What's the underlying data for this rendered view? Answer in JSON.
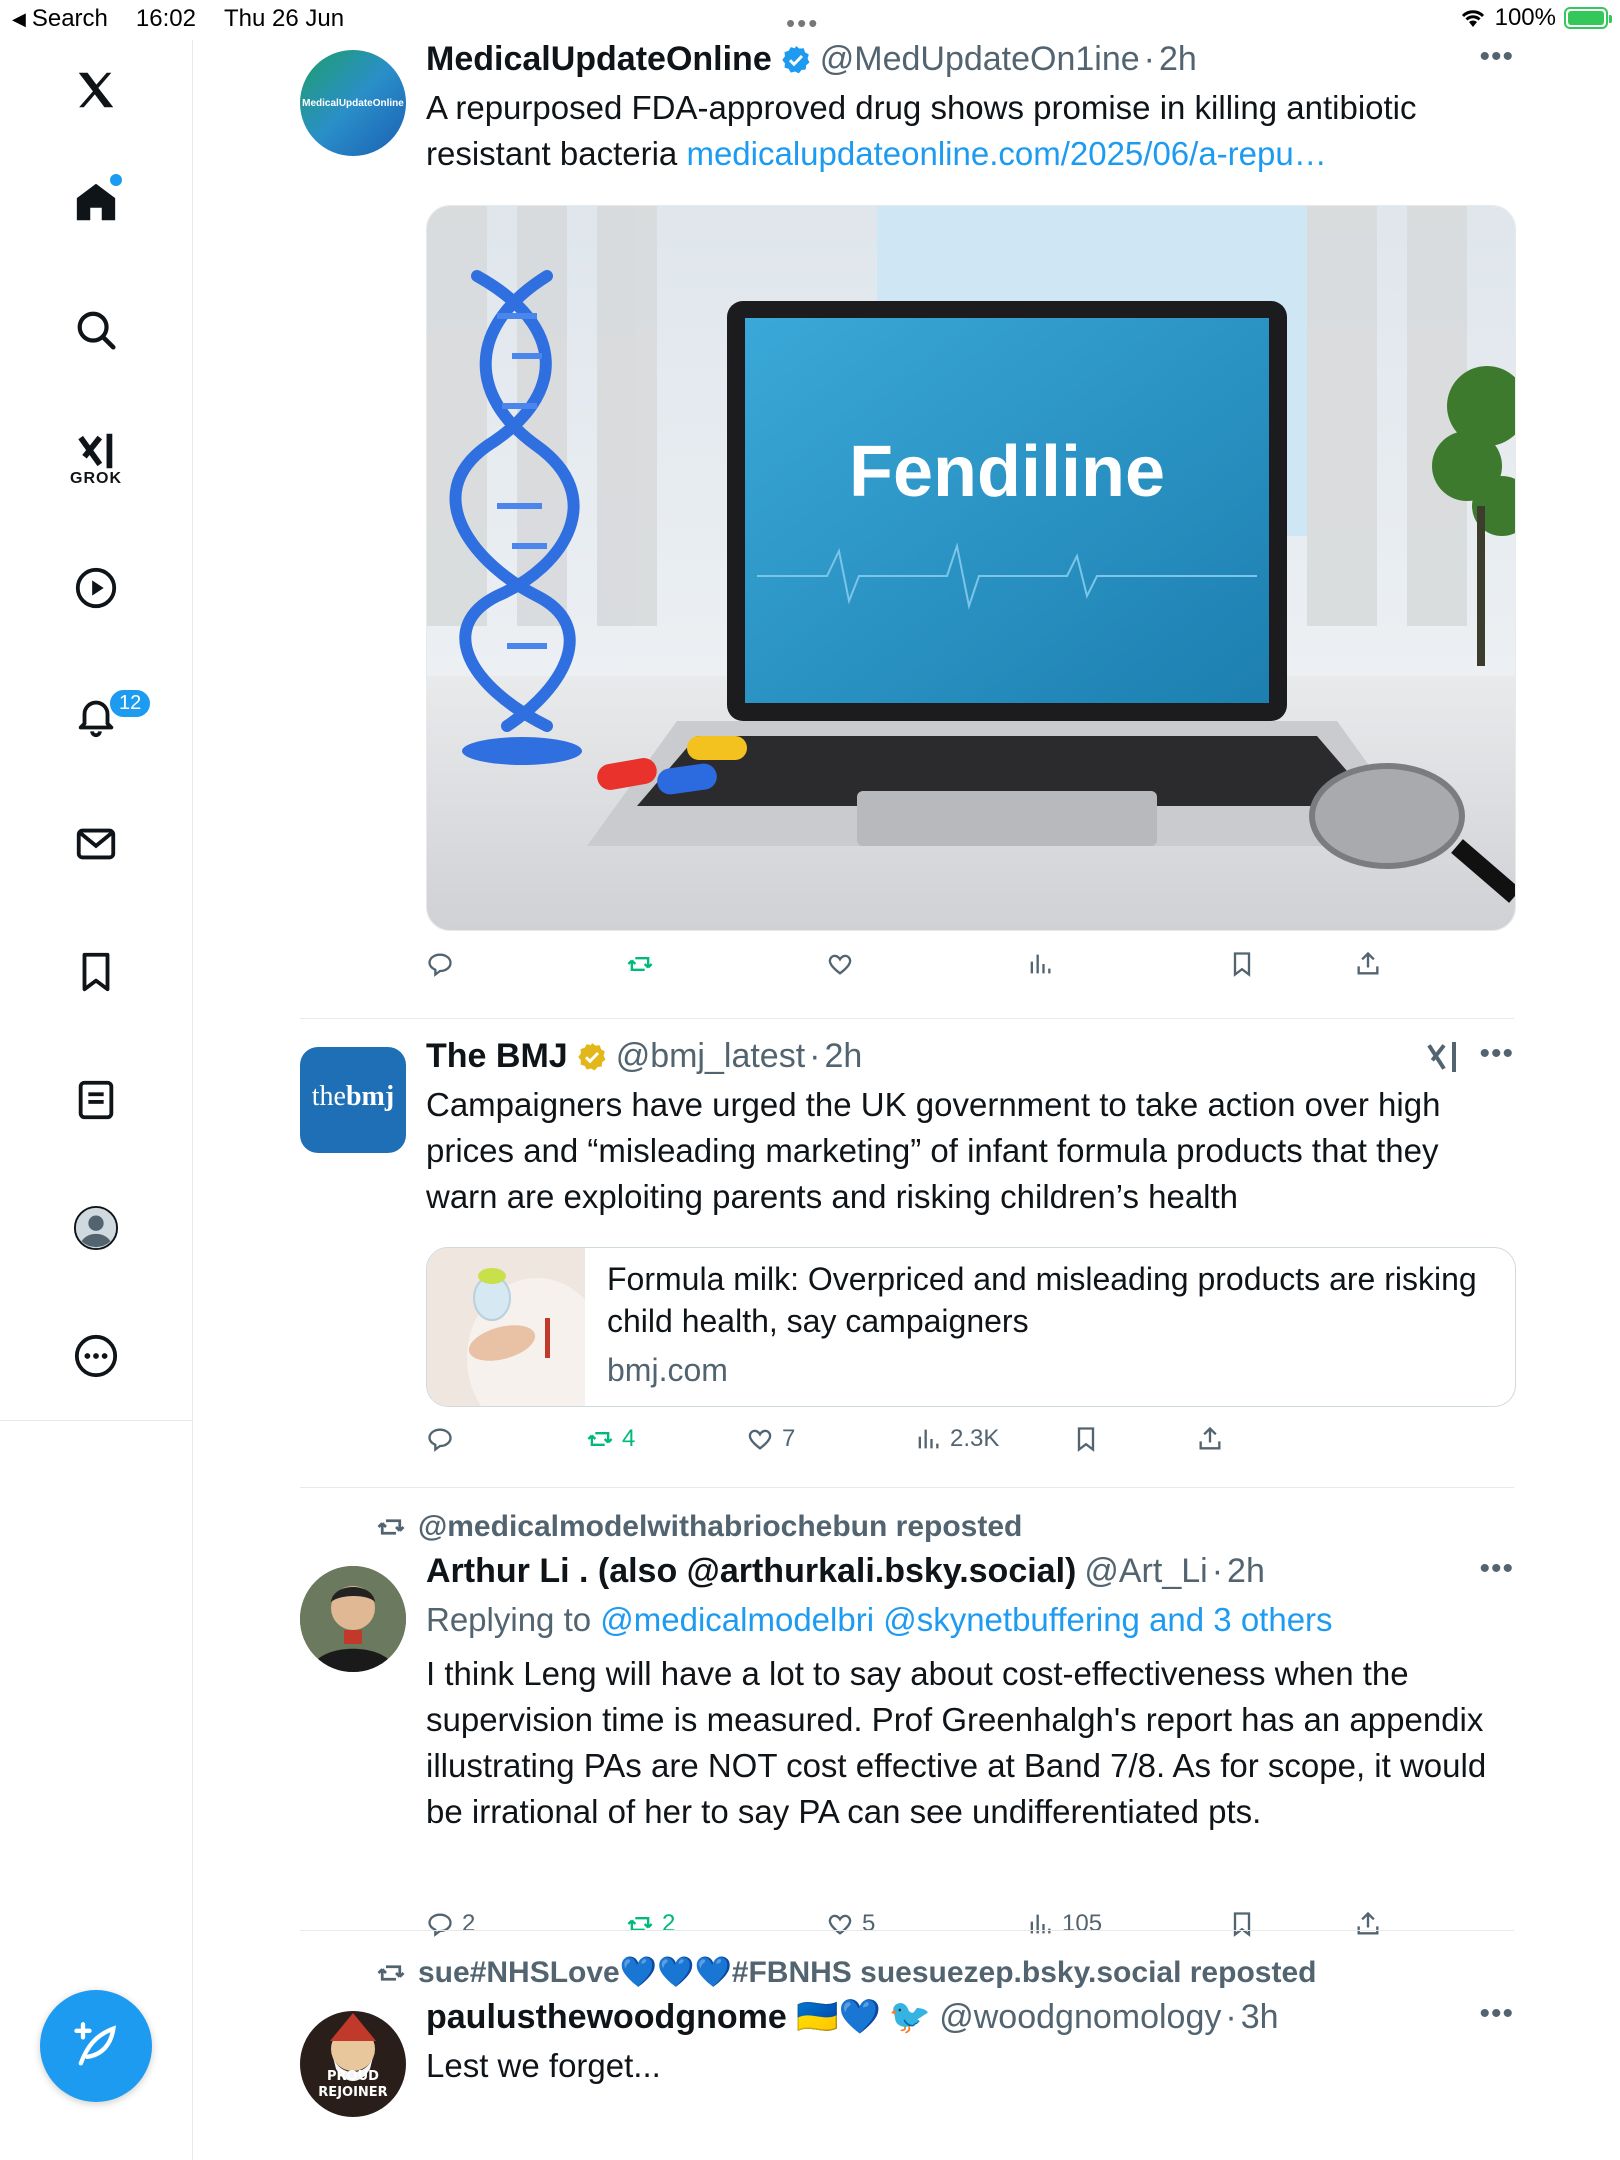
{
  "status": {
    "back_label": "Search",
    "time": "16:02",
    "date": "Thu 26 Jun",
    "battery": "100%",
    "battery_level": 1.0
  },
  "sidebar": {
    "grok_label": "GROK",
    "notifications_badge": "12"
  },
  "feed": {
    "tweets": [
      {
        "name": "MedicalUpdateOnline",
        "verified": "blue",
        "handle": "@MedUpdateOn1ine",
        "time": "2h",
        "avatar_text": "MedicalUpdateOnline",
        "text": "A repurposed FDA-approved drug shows promise in killing antibiotic resistant bacteria ",
        "link": "medicalupdateonline.com/2025/06/a-repu…",
        "media_text": "Fendiline",
        "actions": {
          "reply": "",
          "repost": "",
          "like": "",
          "views": ""
        }
      },
      {
        "name": "The BMJ",
        "verified": "gold",
        "handle": "@bmj_latest",
        "time": "2h",
        "avatar_text_a": "the",
        "avatar_text_b": "bmj",
        "text": "Campaigners have urged the UK government to take action over high prices and “misleading marketing” of infant formula products that they warn are exploiting parents and risking children’s health",
        "card_title": "Formula milk: Overpriced and misleading products are risking child health, say campaigners",
        "card_domain": "bmj.com",
        "actions": {
          "reply": "",
          "repost": "4",
          "like": "7",
          "views": "2.3K"
        }
      },
      {
        "repost_by": "@medicalmodelwithabriochebun reposted",
        "name": "Arthur Li . (also @arthurkali.bsky.social)",
        "handle": "@Art_Li",
        "time": "2h",
        "replying_prefix": "Replying to ",
        "replying_to": "@medicalmodelbri @skynetbuffering and 3 others",
        "text": "I think Leng will have a lot to say about cost-effectiveness when the supervision time is measured. Prof Greenhalgh's report has an appendix illustrating PAs are NOT cost effective at Band 7/8. As for scope, it would be irrational of her to say PA can see undifferentiated pts.",
        "actions": {
          "reply": "2",
          "repost": "2",
          "like": "5",
          "views": "105"
        }
      },
      {
        "repost_by": "sue#NHSLove💙💙💙#FBNHS suesuezep.bsky.social reposted",
        "name": "paulusthewoodgnome 🇺🇦💙",
        "handle": "@woodgnomology",
        "time": "3h",
        "avatar_text": "PROUD REJOINER",
        "text": "Lest we forget..."
      }
    ]
  },
  "colors": {
    "accent": "#1d9bf0",
    "repost_green": "#00ba7c",
    "muted": "#536471",
    "verified_gold": "#e2b719"
  }
}
